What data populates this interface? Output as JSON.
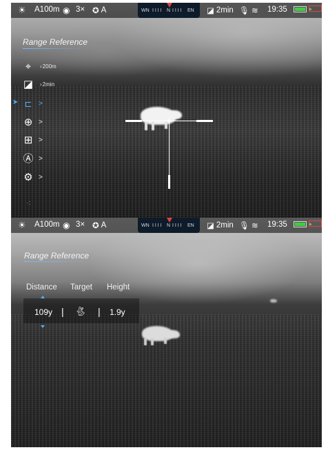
{
  "status_bar": {
    "mode_icon": "sun-icon",
    "ammo_label": "A100m",
    "zoom": "3×",
    "auto_label": "A",
    "compass": {
      "left": "WN",
      "center": "N",
      "right": "EN",
      "ticks": "I I I I"
    },
    "timer": "2min",
    "time": "19:35",
    "battery_color": "#3fcf3f",
    "low_battery_color": "#e04646"
  },
  "screen1": {
    "title": "Range Reference",
    "menu": [
      {
        "icon": "crosshair-icon",
        "value": "200m",
        "chevron": ">"
      },
      {
        "icon": "screen-off-icon",
        "value": "2min",
        "chevron": ">"
      },
      {
        "icon": "range-reference-icon",
        "value": "",
        "chevron": ">",
        "active": true
      },
      {
        "icon": "target-reticle-icon",
        "value": "",
        "chevron": ">"
      },
      {
        "icon": "plus-box-icon",
        "value": "",
        "chevron": ">"
      },
      {
        "icon": "auto-icon",
        "value": "",
        "chevron": ">"
      },
      {
        "icon": "settings-icon",
        "value": "",
        "chevron": ">"
      }
    ],
    "accent_color": "#4fb0ff"
  },
  "screen2": {
    "title": "Range Reference",
    "headers": {
      "distance": "Distance",
      "target": "Target",
      "height": "Height"
    },
    "values": {
      "distance": "109y",
      "separator": "|",
      "target_icon": "rabbit-icon",
      "height": "1.9y"
    }
  }
}
